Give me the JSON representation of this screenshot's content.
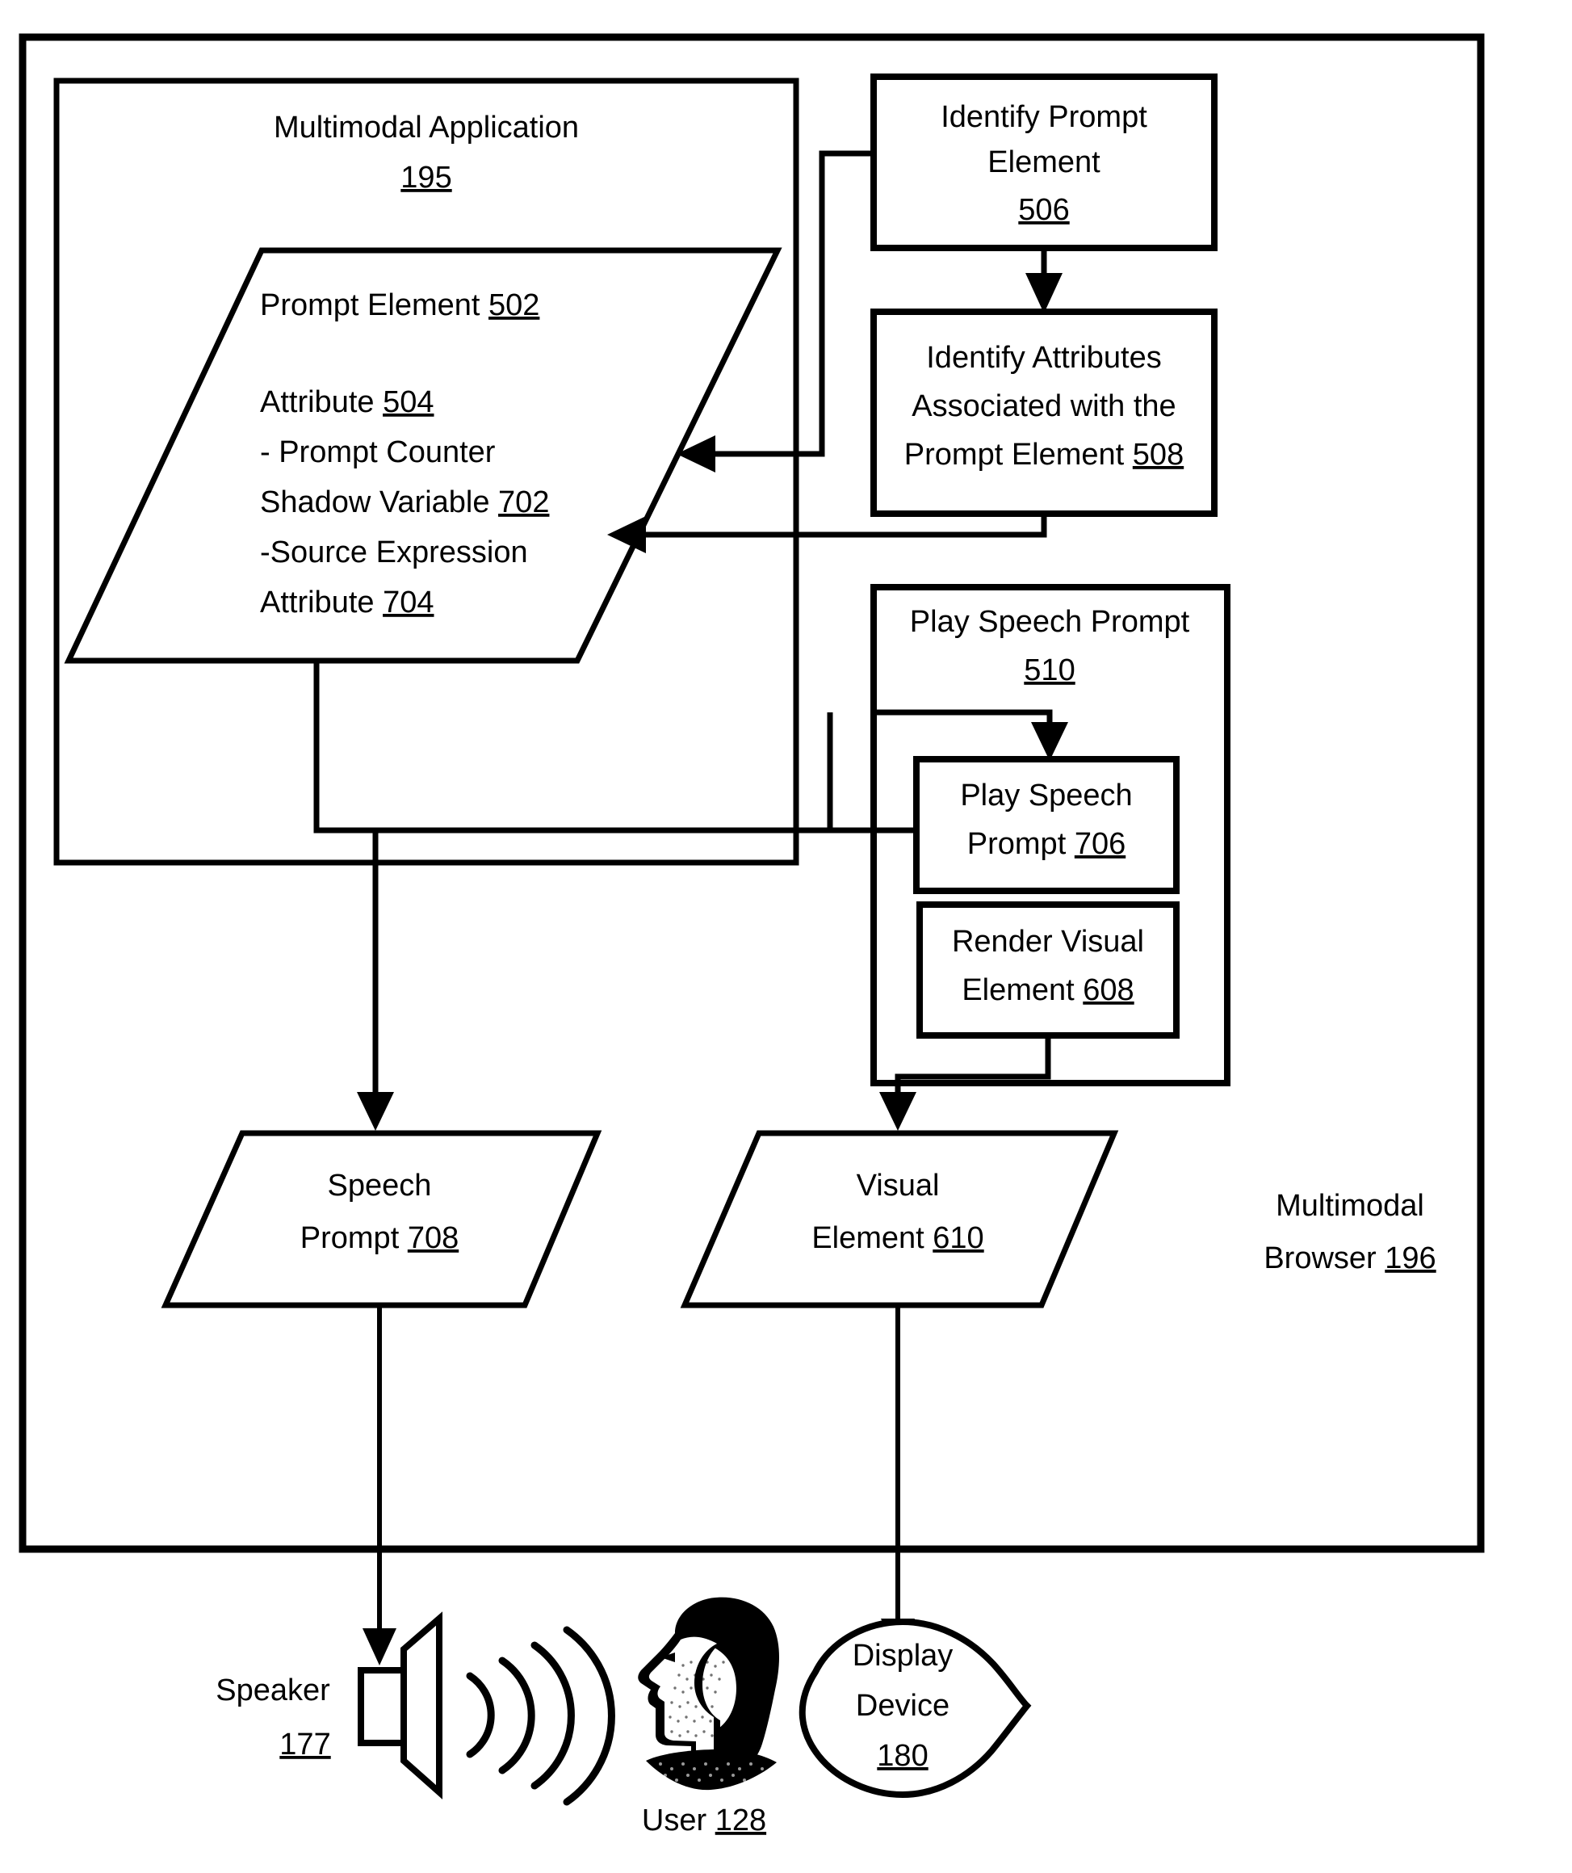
{
  "figure": {
    "outer_container": {
      "label_line1": "Multimodal",
      "label_line2_text": "Browser",
      "label_line2_num": "196"
    },
    "application_container": {
      "title": "Multimodal Application",
      "num": "195"
    },
    "prompt_element_data": {
      "line1_text": "Prompt Element",
      "line1_num": "502",
      "line2_text": "Attribute",
      "line2_num": "504",
      "line3_text": "- Prompt Counter",
      "line4_text": "Shadow Variable",
      "line4_num": "702",
      "line5_text": "-Source Expression",
      "line6_text": "Attribute",
      "line6_num": "704"
    },
    "process_boxes": [
      {
        "id": "identify-prompt-element",
        "lines": [
          "Identify Prompt",
          "Element"
        ],
        "num": "506",
        "num_inline": false
      },
      {
        "id": "identify-attributes",
        "lines": [
          "Identify Attributes",
          "Associated with the",
          "Prompt Element"
        ],
        "num": "508",
        "num_inline": true
      }
    ],
    "play_speech_group": {
      "title": "Play Speech Prompt",
      "num": "510",
      "children": [
        {
          "id": "play-speech-prompt-706",
          "lines": [
            "Play Speech",
            "Prompt"
          ],
          "num": "706"
        },
        {
          "id": "render-visual-element-608",
          "lines": [
            "Render Visual",
            "Element"
          ],
          "num": "608"
        }
      ]
    },
    "output_parallelograms": [
      {
        "id": "speech-prompt-708",
        "line1": "Speech",
        "line2_text": "Prompt",
        "num": "708"
      },
      {
        "id": "visual-element-610",
        "line1": "Visual",
        "line2_text": "Element",
        "num": "610"
      }
    ],
    "devices": [
      {
        "id": "speaker",
        "icon": "speaker-icon",
        "label": "Speaker",
        "num": "177"
      },
      {
        "id": "user",
        "icon": "user-head-icon",
        "label": "User",
        "num": "128"
      },
      {
        "id": "display-device",
        "icon": "display-device-icon",
        "line1": "Display",
        "line2": "Device",
        "num": "180"
      }
    ],
    "colors": {
      "stroke": "#000000",
      "fill": "#ffffff"
    }
  }
}
